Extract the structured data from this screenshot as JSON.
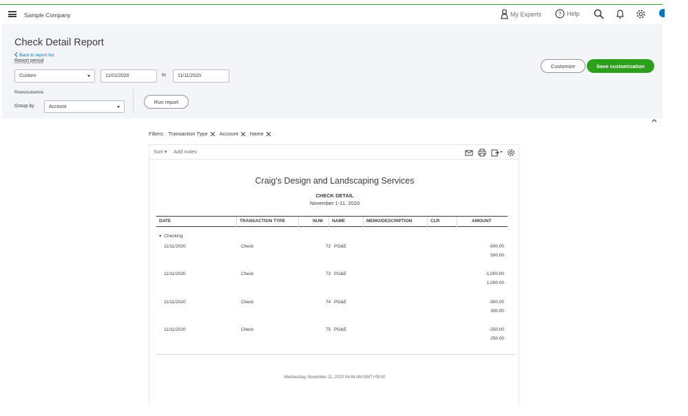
{
  "topbar": {
    "company": "Sample Company",
    "my_experts": "My Experts",
    "help": "Help"
  },
  "header": {
    "title": "Check Detail Report",
    "back_link": "Back to report list",
    "period_label": "Report period",
    "period_value": "Custom",
    "date_from": "11/01/2020",
    "to_label": "to",
    "date_to": "11/11/2020",
    "rows_columns_label": "Rows/columns",
    "group_by_label": "Group by",
    "group_by_value": "Account",
    "run_report": "Run report",
    "customize": "Customize",
    "save_customization": "Save customization"
  },
  "filters": {
    "label": "Filters:",
    "chips": [
      "Transaction Type",
      "Account",
      "Name"
    ]
  },
  "report": {
    "sort": "Sort",
    "add_notes": "Add notes",
    "company_name": "Craig's Design and Landscaping Services",
    "report_name": "CHECK DETAIL",
    "date_range": "November 1-11, 2020",
    "columns": [
      "DATE",
      "TRANSACTION TYPE",
      "NUM",
      "NAME",
      "MEMO/DESCRIPTION",
      "CLR",
      "AMOUNT"
    ],
    "group": "Checking",
    "rows": [
      {
        "date": "11/11/2020",
        "type": "Check",
        "num": "72",
        "name": "PG&E",
        "amount": "-500.00",
        "amount2": "500.00"
      },
      {
        "date": "11/11/2020",
        "type": "Check",
        "num": "73",
        "name": "PG&E",
        "amount": "-1,000.00",
        "amount2": "1,000.00"
      },
      {
        "date": "11/11/2020",
        "type": "Check",
        "num": "74",
        "name": "PG&E",
        "amount": "-300.00",
        "amount2": "300.00"
      },
      {
        "date": "11/11/2020",
        "type": "Check",
        "num": "75",
        "name": "PG&E",
        "amount": "-250.00",
        "amount2": "250.00"
      }
    ],
    "footer": "Wednesday, November 11, 2020  04:44 AM GMT+08:00"
  },
  "colors": {
    "accent_green": "#2ca01c",
    "link_blue": "#0077c5",
    "text": "#393a3d"
  }
}
